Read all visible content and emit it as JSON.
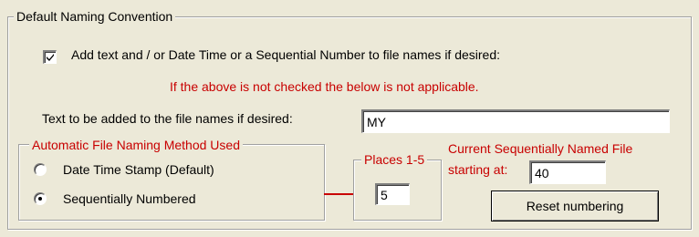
{
  "group": {
    "title": "Default  Naming Convention"
  },
  "add_text_checkbox": {
    "label": "Add text and / or Date Time or a Sequential Number to file names if desired:",
    "checked": true
  },
  "warning_text": "If the above is not checked the below is not applicable.",
  "text_to_add": {
    "label": "Text to be added to the file names if desired:",
    "value": "MY"
  },
  "naming_method": {
    "title": "Automatic File Naming Method Used",
    "options": [
      {
        "label": "Date Time Stamp (Default)",
        "selected": false
      },
      {
        "label": "Sequentially Numbered",
        "selected": true
      }
    ]
  },
  "places": {
    "title": "Places 1-5",
    "value": "5"
  },
  "sequence": {
    "label_line1": "Current Sequentially Named File",
    "label_line2": "starting at:",
    "value": "40"
  },
  "reset_button": {
    "label": "Reset numbering"
  },
  "colors": {
    "accent_red": "#c80000",
    "dialog_bg": "#ece9d8"
  }
}
